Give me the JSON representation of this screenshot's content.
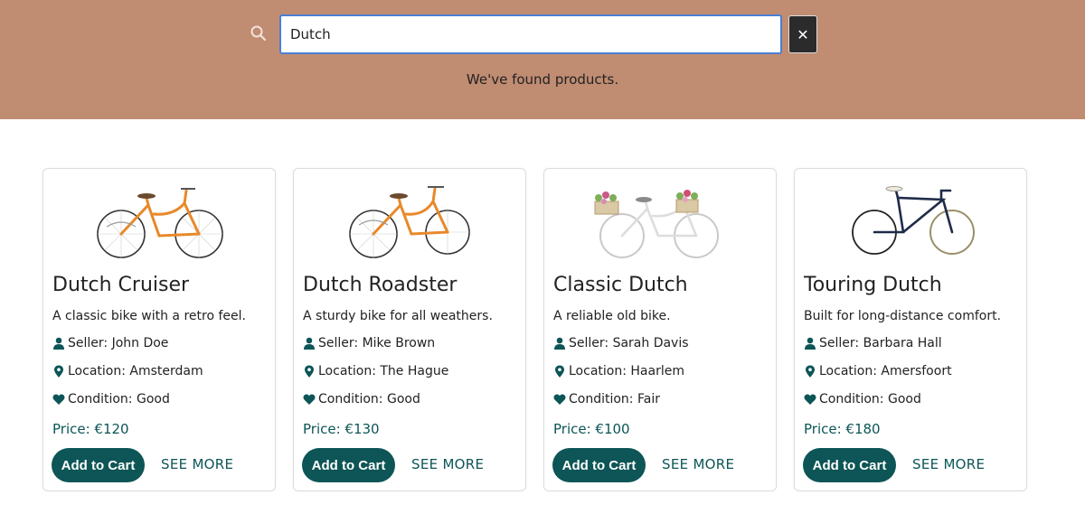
{
  "search": {
    "value": "Dutch",
    "placeholder": "",
    "result_message": "We've found products.",
    "clear_symbol": "✕"
  },
  "colors": {
    "header_bg": "#c08c72",
    "accent": "#0d5556",
    "input_border": "#4a7fd4"
  },
  "products": [
    {
      "title": "Dutch Cruiser",
      "description": "A classic bike with a retro feel.",
      "seller": "Seller: John Doe",
      "location": "Location: Amsterdam",
      "condition": "Condition: Good",
      "price": "Price: €120",
      "cart_label": "Add to Cart",
      "more_label": "SEE MORE",
      "image": "orange-step-through-bike"
    },
    {
      "title": "Dutch Roadster",
      "description": "A sturdy bike for all weathers.",
      "seller": "Seller: Mike Brown",
      "location": "Location: The Hague",
      "condition": "Condition: Good",
      "price": "Price: €130",
      "cart_label": "Add to Cart",
      "more_label": "SEE MORE",
      "image": "orange-step-through-bike"
    },
    {
      "title": "Classic Dutch",
      "description": "A reliable old bike.",
      "seller": "Seller: Sarah Davis",
      "location": "Location: Haarlem",
      "condition": "Condition: Fair",
      "price": "Price: €100",
      "cart_label": "Add to Cart",
      "more_label": "SEE MORE",
      "image": "white-bike-with-flower-baskets"
    },
    {
      "title": "Touring Dutch",
      "description": "Built for long-distance comfort.",
      "seller": "Seller: Barbara Hall",
      "location": "Location: Amersfoort",
      "condition": "Condition: Good",
      "price": "Price: €180",
      "cart_label": "Add to Cart",
      "more_label": "SEE MORE",
      "image": "navy-diamond-frame-bike"
    }
  ]
}
